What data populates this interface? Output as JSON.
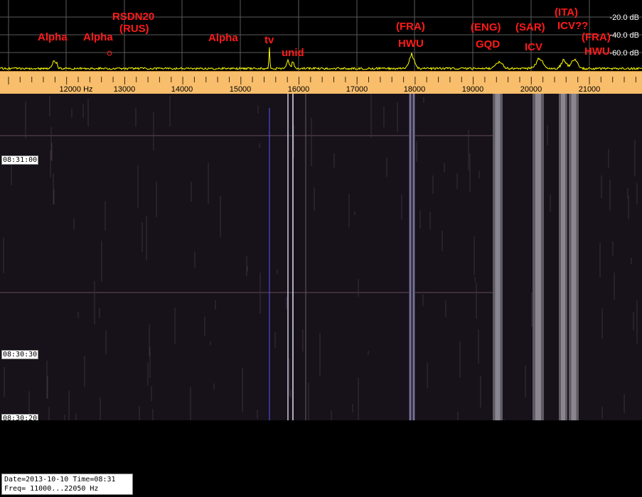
{
  "spectrum": {
    "db_labels": [
      "-20.0 dB",
      "-40.0 dB",
      "-60.0 dB"
    ],
    "stations": [
      {
        "id": "alpha-1",
        "text": "Alpha"
      },
      {
        "id": "alpha-2",
        "text": "Alpha"
      },
      {
        "id": "rsdn20",
        "text": "RSDN20"
      },
      {
        "id": "rus",
        "text": "(RUS)"
      },
      {
        "id": "alpha-3",
        "text": "Alpha"
      },
      {
        "id": "tv",
        "text": "tv"
      },
      {
        "id": "unid",
        "text": "unid"
      },
      {
        "id": "fra-1",
        "text": "(FRA)"
      },
      {
        "id": "hwu-1",
        "text": "HWU"
      },
      {
        "id": "eng",
        "text": "(ENG)"
      },
      {
        "id": "gqd",
        "text": "GQD"
      },
      {
        "id": "sar",
        "text": "(SAR)"
      },
      {
        "id": "icv",
        "text": "ICV"
      },
      {
        "id": "ita",
        "text": "(ITA)"
      },
      {
        "id": "icv-q",
        "text": "ICV??"
      },
      {
        "id": "fra-2",
        "text": "(FRA)"
      },
      {
        "id": "hwu-2",
        "text": "HWU"
      }
    ]
  },
  "ruler": {
    "labels": [
      "12000 Hz",
      "13000",
      "14000",
      "15000",
      "16000",
      "17000",
      "18000",
      "19000",
      "20000",
      "21000"
    ]
  },
  "waterfall": {
    "time_labels": [
      "08:31:00",
      "08:30:30",
      "08:30:20"
    ]
  },
  "info": {
    "line1": "Date=2013-10-10 Time=08:31",
    "line2": "Freq= 11000...22050 Hz"
  },
  "colors": {
    "ruler_bg": "#f9be6c",
    "spectrum_trace": "#ffff00",
    "station_label": "#ff1a1a",
    "waterfall_bg": "#171119"
  }
}
